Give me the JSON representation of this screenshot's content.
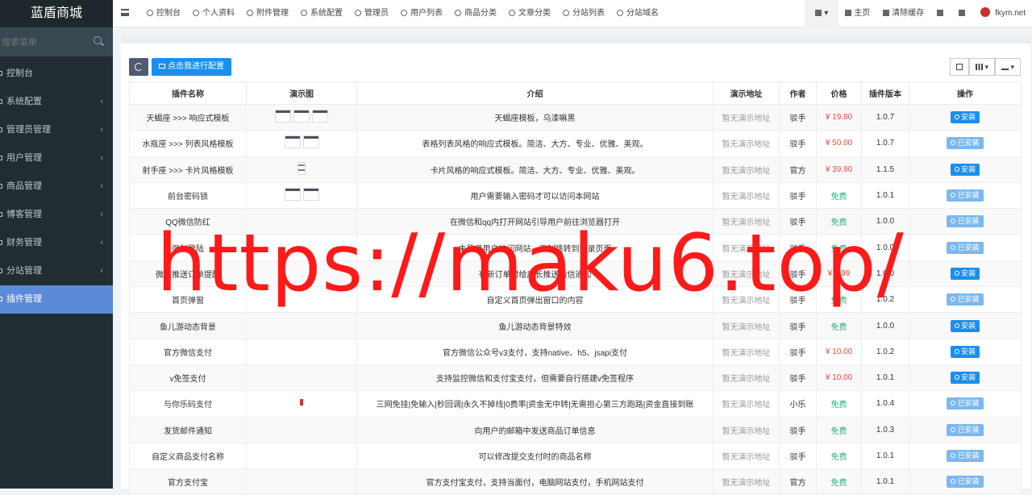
{
  "app": {
    "title": "蓝盾商城"
  },
  "sidebar": {
    "search_placeholder": "搜索菜单",
    "items": [
      {
        "label": "控制台",
        "chevron": ""
      },
      {
        "label": "系统配置",
        "chevron": "‹"
      },
      {
        "label": "管理员管理",
        "chevron": "‹"
      },
      {
        "label": "用户管理",
        "chevron": "‹"
      },
      {
        "label": "商品管理",
        "chevron": "‹"
      },
      {
        "label": "博客管理",
        "chevron": "‹"
      },
      {
        "label": "财务管理",
        "chevron": "‹"
      },
      {
        "label": "分站管理",
        "chevron": "‹"
      },
      {
        "label": "插件管理",
        "chevron": ""
      }
    ]
  },
  "topnav": {
    "items": [
      "控制台",
      "个人资料",
      "附件管理",
      "系统配置",
      "管理员",
      "用户列表",
      "商品分类",
      "文章分类",
      "分站列表",
      "分站域名"
    ],
    "right": {
      "home": "主页",
      "clear_cache": "清除缓存",
      "user": "fkym.net"
    }
  },
  "toolbar": {
    "config_button": "点击我进行配置"
  },
  "table": {
    "headers": [
      "插件名称",
      "演示图",
      "介绍",
      "演示地址",
      "作者",
      "价格",
      "插件版本",
      "操作"
    ],
    "rows": [
      {
        "name": "天蝎座 >>> 响应式模板",
        "thumbs": "3",
        "desc": "天蝎座模板，乌漆嘛黑",
        "demo": "暂无演示地址",
        "author": "驳手",
        "price": "¥ 19.80",
        "paid": true,
        "version": "1.0.7",
        "action": "安装",
        "installed": false
      },
      {
        "name": "水瓶座 >>> 列表风格模板",
        "thumbs": "2",
        "desc": "表格列表风格的响应式模板。简洁、大方、专业、优雅、美观。",
        "demo": "暂无演示地址",
        "author": "驳手",
        "price": "¥ 50.00",
        "paid": true,
        "version": "1.0.7",
        "action": "已安装",
        "installed": true
      },
      {
        "name": "射手座 >>> 卡片风格模板",
        "thumbs": "1",
        "desc": "卡片风格的响应式模板。简洁、大方、专业、优雅、美观。",
        "demo": "暂无演示地址",
        "author": "官方",
        "price": "¥ 39.90",
        "paid": true,
        "version": "1.1.5",
        "action": "安装",
        "installed": false
      },
      {
        "name": "前台密码锁",
        "thumbs": "2",
        "desc": "用户需要输入密码才可以访问本网站",
        "demo": "暂无演示地址",
        "author": "驳手",
        "price": "免费",
        "paid": false,
        "version": "1.0.1",
        "action": "已安装",
        "installed": true
      },
      {
        "name": "QQ微信防红",
        "thumbs": "0",
        "desc": "在微信和qq内打开网站引导用户前往浏览器打开",
        "demo": "暂无演示地址",
        "author": "驳手",
        "price": "免费",
        "paid": false,
        "version": "1.0.0",
        "action": "已安装",
        "installed": true
      },
      {
        "name": "强制登陆",
        "thumbs": "0",
        "desc": "未登录用户访问网站，强制跳转到登录页面",
        "demo": "暂无演示地址",
        "author": "驳手",
        "price": "免费",
        "paid": false,
        "version": "1.0.0",
        "action": "已安装",
        "installed": true
      },
      {
        "name": "微信推送订单提醒",
        "thumbs": "0",
        "desc": "有新订单时给店长推送微信通知",
        "demo": "暂无演示地址",
        "author": "驳手",
        "price": "¥ 9.99",
        "paid": true,
        "version": "1.0.0",
        "action": "安装",
        "installed": false
      },
      {
        "name": "首页弹窗",
        "thumbs": "0",
        "desc": "自定义首页弹出窗口的内容",
        "demo": "暂无演示地址",
        "author": "驳手",
        "price": "免费",
        "paid": false,
        "version": "1.0.2",
        "action": "已安装",
        "installed": true
      },
      {
        "name": "鱼儿游动态背景",
        "thumbs": "0",
        "desc": "鱼儿游动态背景特效",
        "demo": "暂无演示地址",
        "author": "驳手",
        "price": "免费",
        "paid": false,
        "version": "1.0.0",
        "action": "安装",
        "installed": false
      },
      {
        "name": "官方微信支付",
        "thumbs": "0",
        "desc": "官方微信公众号v3支付，支持native、h5、jsapi支付",
        "demo": "暂无演示地址",
        "author": "驳手",
        "price": "¥ 10.00",
        "paid": true,
        "version": "1.0.2",
        "action": "安装",
        "installed": false
      },
      {
        "name": "v免签支付",
        "thumbs": "0",
        "desc": "支持监控微信和支付宝支付，但需要自行搭建v免签程序",
        "demo": "暂无演示地址",
        "author": "驳手",
        "price": "¥ 10.00",
        "paid": true,
        "version": "1.0.1",
        "action": "安装",
        "installed": false
      },
      {
        "name": "与你乐码支付",
        "thumbs": "dot",
        "desc": "三网免挂|免输入|秒回调|永久不掉线|0费率|资金无中转|无需担心第三方跑路|资金直接到账",
        "demo": "暂无演示地址",
        "author": "小乐",
        "price": "免费",
        "paid": false,
        "version": "1.0.4",
        "action": "已安装",
        "installed": true
      },
      {
        "name": "发货邮件通知",
        "thumbs": "0",
        "desc": "向用户的邮箱中发送商品订单信息",
        "demo": "暂无演示地址",
        "author": "驳手",
        "price": "免费",
        "paid": false,
        "version": "1.0.3",
        "action": "已安装",
        "installed": true
      },
      {
        "name": "自定义商品支付名称",
        "thumbs": "0",
        "desc": "可以修改提交支付时的商品名称",
        "demo": "暂无演示地址",
        "author": "驳手",
        "price": "免费",
        "paid": false,
        "version": "1.0.1",
        "action": "已安装",
        "installed": true
      },
      {
        "name": "官方支付宝",
        "thumbs": "0",
        "desc": "官方支付宝支付，支持当面付，电脑网站支付，手机网站支付",
        "demo": "暂无演示地址",
        "author": "官方",
        "price": "免费",
        "paid": false,
        "version": "1.0.1",
        "action": "已安装",
        "installed": true
      }
    ]
  },
  "watermark": {
    "text": "https://maku6.top/"
  },
  "colors": {
    "sidebar_bg": "#222d32",
    "active": "#5b8ad8",
    "primary": "#1b8ff0",
    "price_red": "#e84c3d",
    "price_free": "#2ab27b"
  }
}
